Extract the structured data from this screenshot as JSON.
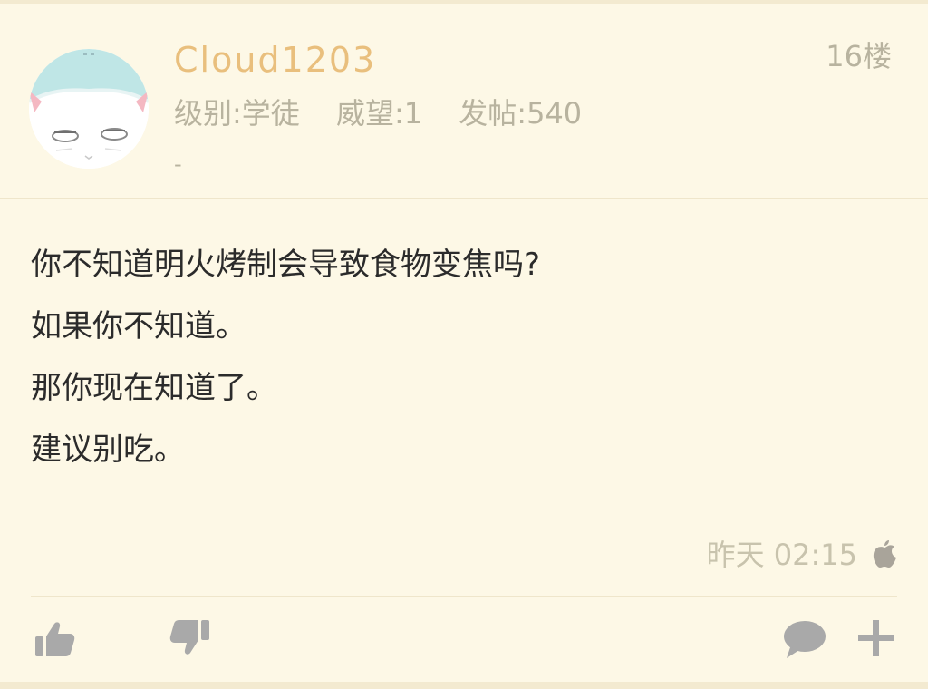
{
  "post": {
    "username": "Cloud1203",
    "floor": "16楼",
    "level": "级别:学徒",
    "prestige": "威望:1",
    "posts_count": "发帖:540",
    "signature": "-",
    "content_lines": [
      "你不知道明火烤制会导致食物变焦吗?",
      "如果你不知道。",
      "那你现在知道了。",
      "建议别吃。"
    ],
    "time": "昨天 02:15",
    "device_icon": "apple-icon"
  },
  "actions": {
    "like_icon": "thumbs-up-icon",
    "dislike_icon": "thumbs-down-icon",
    "comment_icon": "comment-bubble-icon",
    "more_icon": "plus-icon"
  },
  "colors": {
    "background": "#fdf8e6",
    "username": "#e9bf7d",
    "meta_text": "#b8b39f",
    "content_text": "#2b2b2b",
    "icon": "#a9a9a9"
  }
}
